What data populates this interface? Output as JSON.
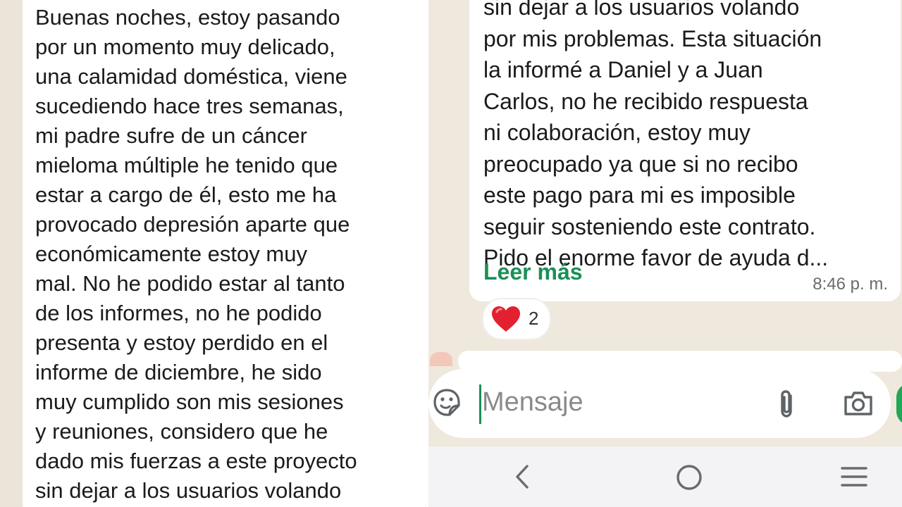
{
  "left_message": {
    "text": "Buenas noches,  estoy pasando\npor un momento muy delicado,\nuna calamidad doméstica, viene\nsucediendo hace tres semanas,\nmi padre sufre de un cáncer\nmieloma múltiple he tenido que\nestar a cargo de él,  esto me ha\nprovocado depresión aparte que\neconómicamente estoy muy\nmal. No he podido estar al tanto\nde los informes, no he podido\npresenta y estoy perdido en el\ninforme de diciembre, he sido\nmuy cumplido son mis sesiones\ny reuniones, considero que he\ndado mis fuerzas a este proyecto\nsin dejar a los usuarios volando"
  },
  "right_message": {
    "text": "sin dejar a los usuarios volando\npor mis problemas. Esta situación\nla informé a Daniel y a Juan\nCarlos, no he recibido respuesta\nni colaboración, estoy muy\npreocupado ya que si no recibo\neste pago para mi es imposible\nseguir sosteniendo este contrato.\nPido el enorme favor de ayuda d...",
    "read_more": "Leer más",
    "timestamp": "8:46 p. m.",
    "reaction_count": "2"
  },
  "composer": {
    "placeholder": "Mensaje"
  },
  "icons": {
    "sticker": "sticker-icon",
    "attach": "paperclip-icon",
    "camera": "camera-icon",
    "back": "nav-back-icon",
    "home": "nav-home-icon",
    "recent": "nav-recent-icon",
    "reaction": "heart-icon"
  },
  "colors": {
    "accent": "#1b8f56",
    "heart": "#e3202f",
    "wallpaper": "#efe8dd"
  }
}
